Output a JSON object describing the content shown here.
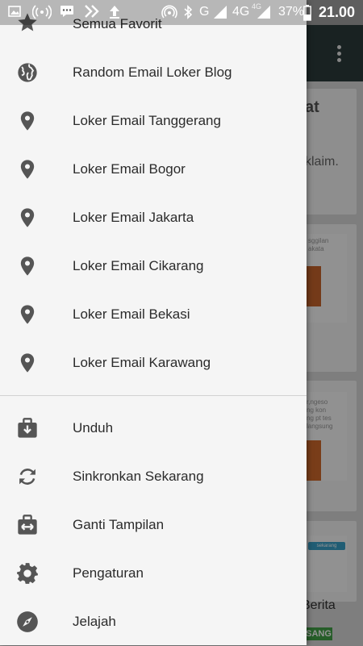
{
  "status_bar": {
    "signal_text": "G",
    "network_text": "4G",
    "network_small": "4G",
    "battery": "37%",
    "time": "21.00"
  },
  "background_app": {
    "card_title_fragment": "at",
    "card_sub_fragment": "klaim.",
    "thumb1_text": "sggilan",
    "thumb1_text2": "akata",
    "thumb2_text": "r,ngeso",
    "thumb2_text2": "ng kon",
    "thumb2_text3": "ng pt tes",
    "thumb2_text4": "langsung",
    "thumb3_chip": "sekarang",
    "bottom_caption": "Berita",
    "badge": "SANG"
  },
  "drawer": {
    "top_item": {
      "label": "Semua Favorit",
      "icon": "star-icon"
    },
    "sections": [
      {
        "label": "Random Email Loker Blog",
        "icon": "globe-icon"
      },
      {
        "label": "Loker Email Tanggerang",
        "icon": "location-pin-icon"
      },
      {
        "label": "Loker Email Bogor",
        "icon": "location-pin-icon"
      },
      {
        "label": "Loker Email Jakarta",
        "icon": "location-pin-icon"
      },
      {
        "label": "Loker Email Cikarang",
        "icon": "location-pin-icon"
      },
      {
        "label": "Loker Email Bekasi",
        "icon": "location-pin-icon"
      },
      {
        "label": "Loker Email Karawang",
        "icon": "location-pin-icon"
      }
    ],
    "actions": [
      {
        "label": "Unduh",
        "icon": "download-briefcase-icon"
      },
      {
        "label": "Sinkronkan Sekarang",
        "icon": "sync-icon"
      },
      {
        "label": "Ganti Tampilan",
        "icon": "switch-view-icon"
      },
      {
        "label": "Pengaturan",
        "icon": "gear-icon"
      },
      {
        "label": "Jelajah",
        "icon": "compass-icon"
      }
    ],
    "icon_color": "#555555",
    "text_color": "#2b2b2b"
  }
}
